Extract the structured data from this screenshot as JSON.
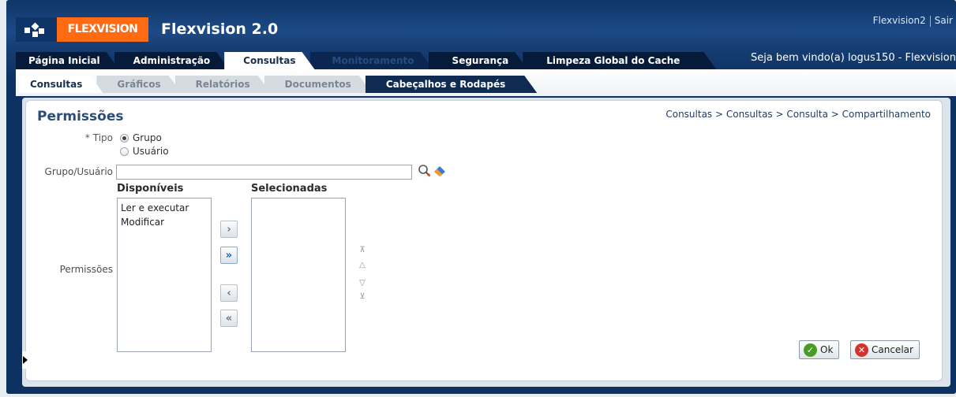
{
  "header": {
    "logo_text": "FLEXVISION",
    "app_title": "Flexvision 2.0",
    "user_link": "Flexvision2",
    "logout_link": "Sair",
    "welcome": "Seja bem vindo(a) logus150 - Flexvision"
  },
  "main_tabs": [
    {
      "label": "Página Inicial"
    },
    {
      "label": "Administração"
    },
    {
      "label": "Consultas"
    },
    {
      "label": "Monitoramento"
    },
    {
      "label": "Segurança"
    },
    {
      "label": "Limpeza Global do Cache"
    }
  ],
  "sub_tabs": [
    {
      "label": "Consultas"
    },
    {
      "label": "Gráficos"
    },
    {
      "label": "Relatórios"
    },
    {
      "label": "Documentos"
    },
    {
      "label": "Cabeçalhos e Rodapés"
    }
  ],
  "page": {
    "title": "Permissões",
    "breadcrumb": "Consultas > Consultas > Consulta > Compartilhamento"
  },
  "form": {
    "tipo_label": "* Tipo",
    "tipo_options": [
      {
        "label": "Grupo",
        "selected": true
      },
      {
        "label": "Usuário",
        "selected": false
      }
    ],
    "grupo_label": "Grupo/Usuário",
    "grupo_value": "",
    "permissoes_label": "Permissões",
    "disponiveis_header": "Disponíveis",
    "selecionadas_header": "Selecionadas",
    "disponiveis_items": [
      "Ler e executar",
      "Modificar"
    ],
    "selecionadas_items": []
  },
  "buttons": {
    "ok": "Ok",
    "cancel": "Cancelar"
  },
  "colors": {
    "header_bg": "#0f3568",
    "logo_orange": "#ff6a13",
    "title_blue": "#2b4d78"
  }
}
